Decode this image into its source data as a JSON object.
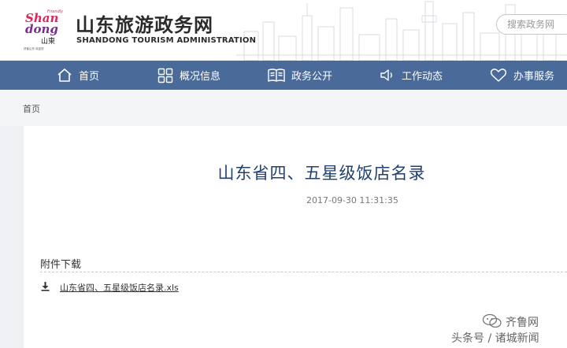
{
  "header": {
    "logo": {
      "word_top": "Shan",
      "word_bottom": "dong",
      "friendly": "Friendly",
      "chinese": "山東",
      "tagline": "好客山东 欢迎您"
    },
    "title": "山东旅游政务网",
    "subtitle": "SHANDONG TOURISM ADMINISTRATION",
    "search_placeholder": "搜索政务网"
  },
  "nav": {
    "items": [
      {
        "label": "首页",
        "icon": "home-icon"
      },
      {
        "label": "概况信息",
        "icon": "grid-icon"
      },
      {
        "label": "政务公开",
        "icon": "book-icon"
      },
      {
        "label": "工作动态",
        "icon": "speaker-icon"
      },
      {
        "label": "办事服务",
        "icon": "heart-icon"
      }
    ]
  },
  "breadcrumb": {
    "home": "首页"
  },
  "article": {
    "title": "山东省四、五星级饭店名录",
    "date": "2017-09-30 11:31:35"
  },
  "attachments": {
    "heading": "附件下载",
    "file_name": "山东省四、五星级饭店名录.xls"
  },
  "watermark": {
    "name": "齐鲁网",
    "source": "头条号 / 诸城新闻"
  },
  "colors": {
    "nav_bg": "#4a6a9a",
    "title_color": "#22406e"
  }
}
